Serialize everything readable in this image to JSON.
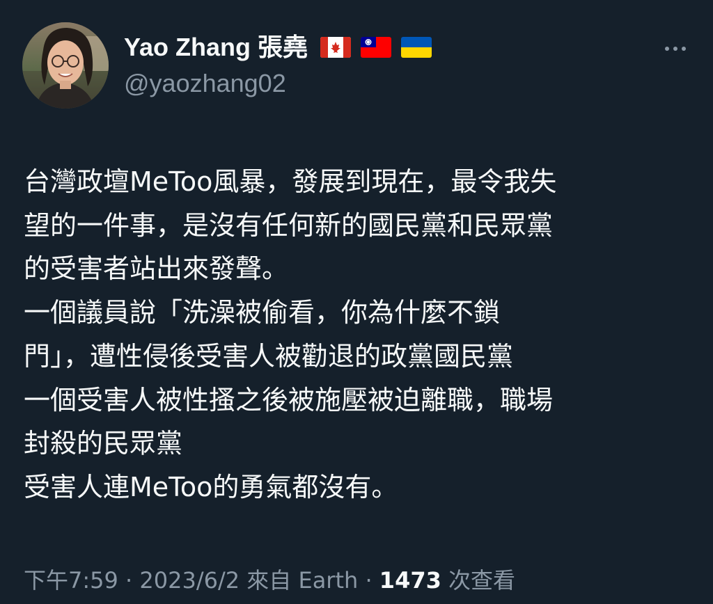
{
  "tweet": {
    "author": {
      "name": "Yao Zhang 張堯",
      "handle": "@yaozhang02",
      "flags": [
        "canada-flag",
        "taiwan-flag",
        "ukraine-flag"
      ]
    },
    "body_lines": [
      "台灣政壇MeToo風暴，發展到現在，最令我失",
      "望的一件事，是沒有任何新的國民黨和民眾黨",
      "的受害者站出來發聲。",
      "一個議員說「洗澡被偷看，你為什麼不鎖",
      "門」，遭性侵後受害人被勸退的政黨國民黨",
      "一個受害人被性搔之後被施壓被迫離職，職場",
      "封殺的民眾黨",
      "受害人連MeToo的勇氣都沒有。"
    ],
    "meta": {
      "time": "下午7:59",
      "separator": " · ",
      "date": "2023/6/2",
      "source_prefix": " 來自 ",
      "source": "Earth",
      "views_count": "1473",
      "views_label": " 次查看"
    },
    "more_icon": "more-horizontal-icon"
  },
  "colors": {
    "background": "#15202b",
    "text_primary": "#f7f9f9",
    "text_secondary": "#8b98a5"
  }
}
